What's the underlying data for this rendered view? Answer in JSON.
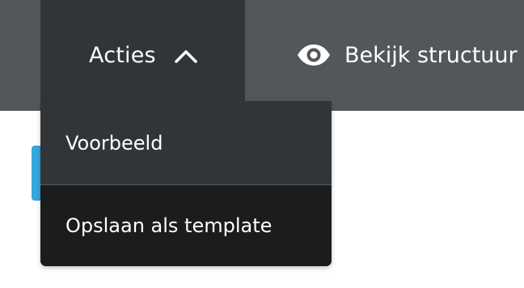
{
  "toolbar": {
    "actions": {
      "label": "Acties",
      "icon": "chevron-up-icon"
    },
    "view_structure": {
      "label": "Bekijk structuur",
      "icon": "eye-icon"
    }
  },
  "actions_menu": {
    "items": [
      {
        "label": "Voorbeeld"
      },
      {
        "label": "Opslaan als template"
      }
    ]
  },
  "colors": {
    "toolbar_bg": "#545759",
    "active_button_bg": "#323537",
    "menu_bg": "#1b1c1e",
    "accent": "#35a7dd",
    "text": "#ffffff"
  }
}
